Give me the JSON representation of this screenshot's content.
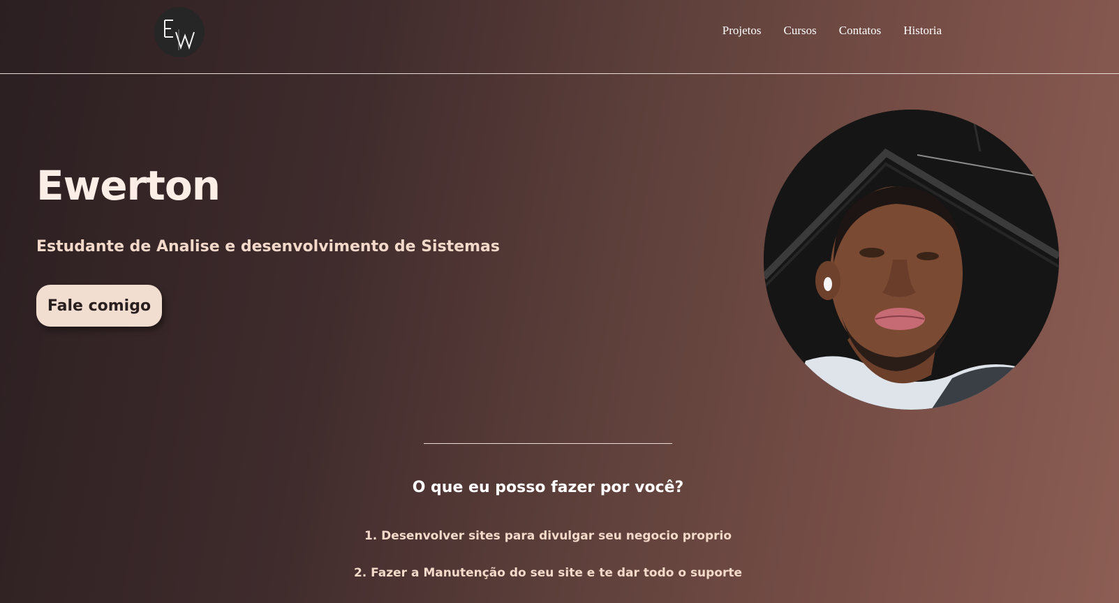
{
  "header": {
    "logo_letters": "EW",
    "nav": [
      "Projetos",
      "Cursos",
      "Contatos",
      "Historia"
    ]
  },
  "hero": {
    "title": "Ewerton",
    "subtitle": "Estudante de Analise e desenvolvimento de Sistemas",
    "cta_label": "Fale comigo"
  },
  "services": {
    "title": "O que eu posso fazer por você?",
    "items": [
      "1. Desenvolver sites para divulgar seu negocio proprio",
      "2. Fazer a Manutenção do seu site e te dar todo o suporte"
    ]
  },
  "colors": {
    "background_dark": "#2b1f21",
    "background_light": "#8c5e54",
    "button_bg": "#f2ddd1",
    "text_light": "#f6e6dc"
  }
}
